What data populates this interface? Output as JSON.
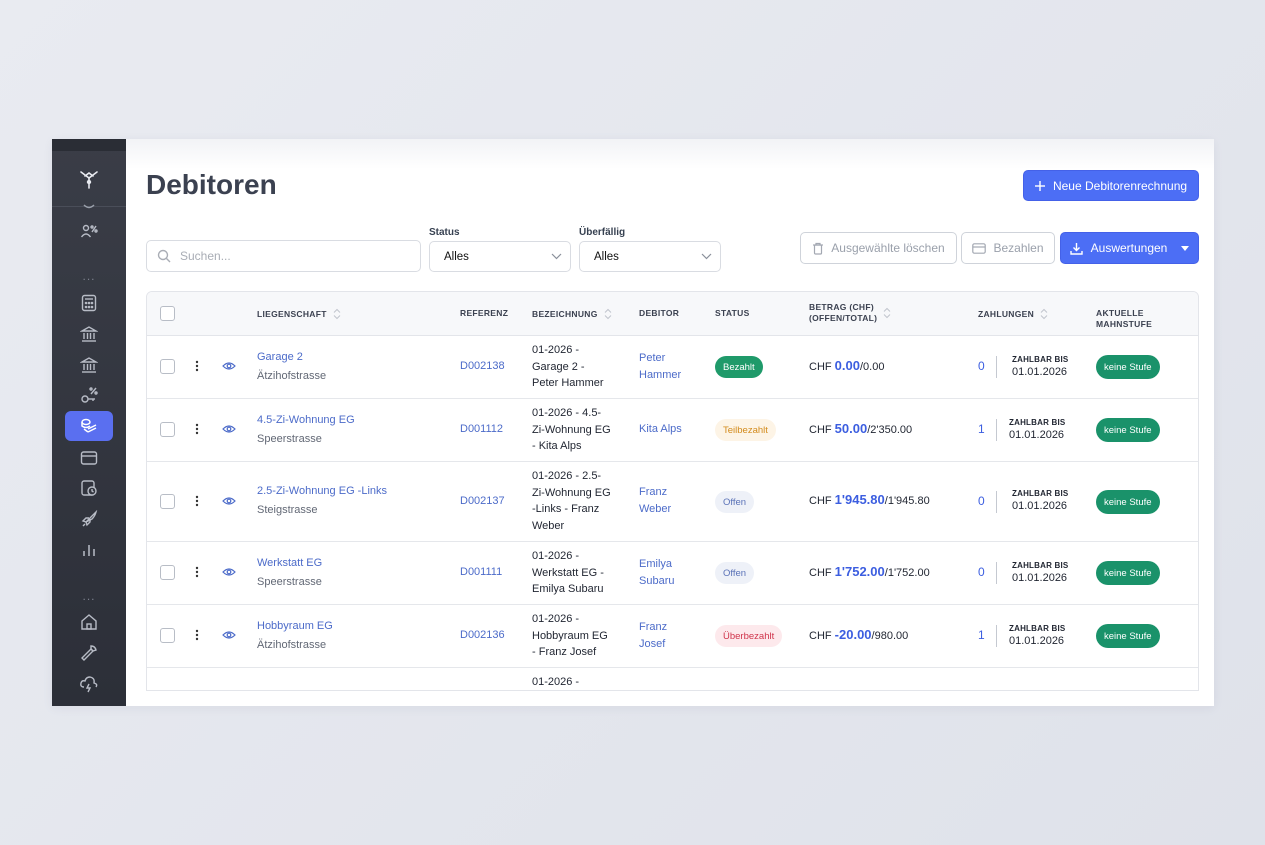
{
  "page": {
    "title": "Debitoren",
    "new_button": "Neue Debitorenrechnung"
  },
  "filters": {
    "search_placeholder": "Suchen...",
    "status_label": "Status",
    "status_value": "Alles",
    "overdue_label": "Überfällig",
    "overdue_value": "Alles"
  },
  "actions": {
    "delete_selected": "Ausgewählte löschen",
    "pay": "Bezahlen",
    "reports": "Auswertungen"
  },
  "sidebar": {
    "dots": "...",
    "icons": [
      "logo-icon",
      "people-percent-icon",
      "calculator-icon",
      "bank-icon",
      "bank-alt-icon",
      "key-percent-icon",
      "money-stack-icon",
      "credit-card-icon",
      "clock-receipt-icon",
      "rocket-icon",
      "bar-chart-icon",
      "home-icon",
      "wrench-icon",
      "cloud-bolt-icon"
    ]
  },
  "table": {
    "headers": {
      "property": "LIEGENSCHAFT",
      "reference": "REFERENZ",
      "description": "BEZEICHNUNG",
      "debtor": "DEBITOR",
      "status": "STATUS",
      "amount_line1": "BETRAG (CHF)",
      "amount_line2": "(OFFEN/TOTAL)",
      "payments": "ZAHLUNGEN",
      "dunning": "AKTUELLE MAHNSTUFE"
    },
    "rows": [
      {
        "property": "Garage 2",
        "street": "Ätzihofstrasse",
        "reference": "D002138",
        "description": [
          "01-2026 -",
          "Garage 2 -",
          "Peter Hammer"
        ],
        "debtor": [
          "Peter",
          "Hammer"
        ],
        "status": "Bezahlt",
        "currency": "CHF",
        "open": "0.00",
        "total": "/0.00",
        "payments": "0",
        "pay_label": "ZAHLBAR BIS",
        "pay_date": "01.01.2026",
        "dunning": "keine Stufe"
      },
      {
        "property": "4.5-Zi-Wohnung EG",
        "street": "Speerstrasse",
        "reference": "D001112",
        "description": [
          "01-2026 - 4.5-",
          "Zi-Wohnung EG",
          "- Kita Alps"
        ],
        "debtor": [
          "Kita Alps",
          ""
        ],
        "status": "Teilbezahlt",
        "currency": "CHF",
        "open": "50.00",
        "total": "/2'350.00",
        "payments": "1",
        "pay_label": "ZAHLBAR BIS",
        "pay_date": "01.01.2026",
        "dunning": "keine Stufe"
      },
      {
        "property": "2.5-Zi-Wohnung EG -Links",
        "street": "Steigstrasse",
        "reference": "D002137",
        "description": [
          "01-2026 - 2.5-",
          "Zi-Wohnung EG",
          "-Links - Franz",
          "Weber"
        ],
        "debtor": [
          "Franz",
          "Weber"
        ],
        "status": "Offen",
        "currency": "CHF",
        "open": "1'945.80",
        "total": "/1'945.80",
        "payments": "0",
        "pay_label": "ZAHLBAR BIS",
        "pay_date": "01.01.2026",
        "dunning": "keine Stufe"
      },
      {
        "property": "Werkstatt EG",
        "street": "Speerstrasse",
        "reference": "D001111",
        "description": [
          "01-2026 -",
          "Werkstatt EG -",
          "Emilya Subaru"
        ],
        "debtor": [
          "Emilya",
          "Subaru"
        ],
        "status": "Offen",
        "currency": "CHF",
        "open": "1'752.00",
        "total": "/1'752.00",
        "payments": "0",
        "pay_label": "ZAHLBAR BIS",
        "pay_date": "01.01.2026",
        "dunning": "keine Stufe"
      },
      {
        "property": "Hobbyraum EG",
        "street": "Ätzihofstrasse",
        "reference": "D002136",
        "description": [
          "01-2026 -",
          "Hobbyraum EG",
          "- Franz Josef"
        ],
        "debtor": [
          "Franz",
          "Josef"
        ],
        "status": "Überbezahlt",
        "currency": "CHF",
        "open": "-20.00",
        "total": "/980.00",
        "payments": "1",
        "pay_label": "ZAHLBAR BIS",
        "pay_date": "01.01.2026",
        "dunning": "keine Stufe"
      }
    ],
    "partial_row_text": "01-2026 -"
  },
  "colors": {
    "accent": "#4c6ef5",
    "sidebar": "#33363f",
    "paid": "#1f9a6a",
    "partial": "#d38b1c",
    "open": "#5b73b8",
    "overpaid": "#d0354c"
  }
}
